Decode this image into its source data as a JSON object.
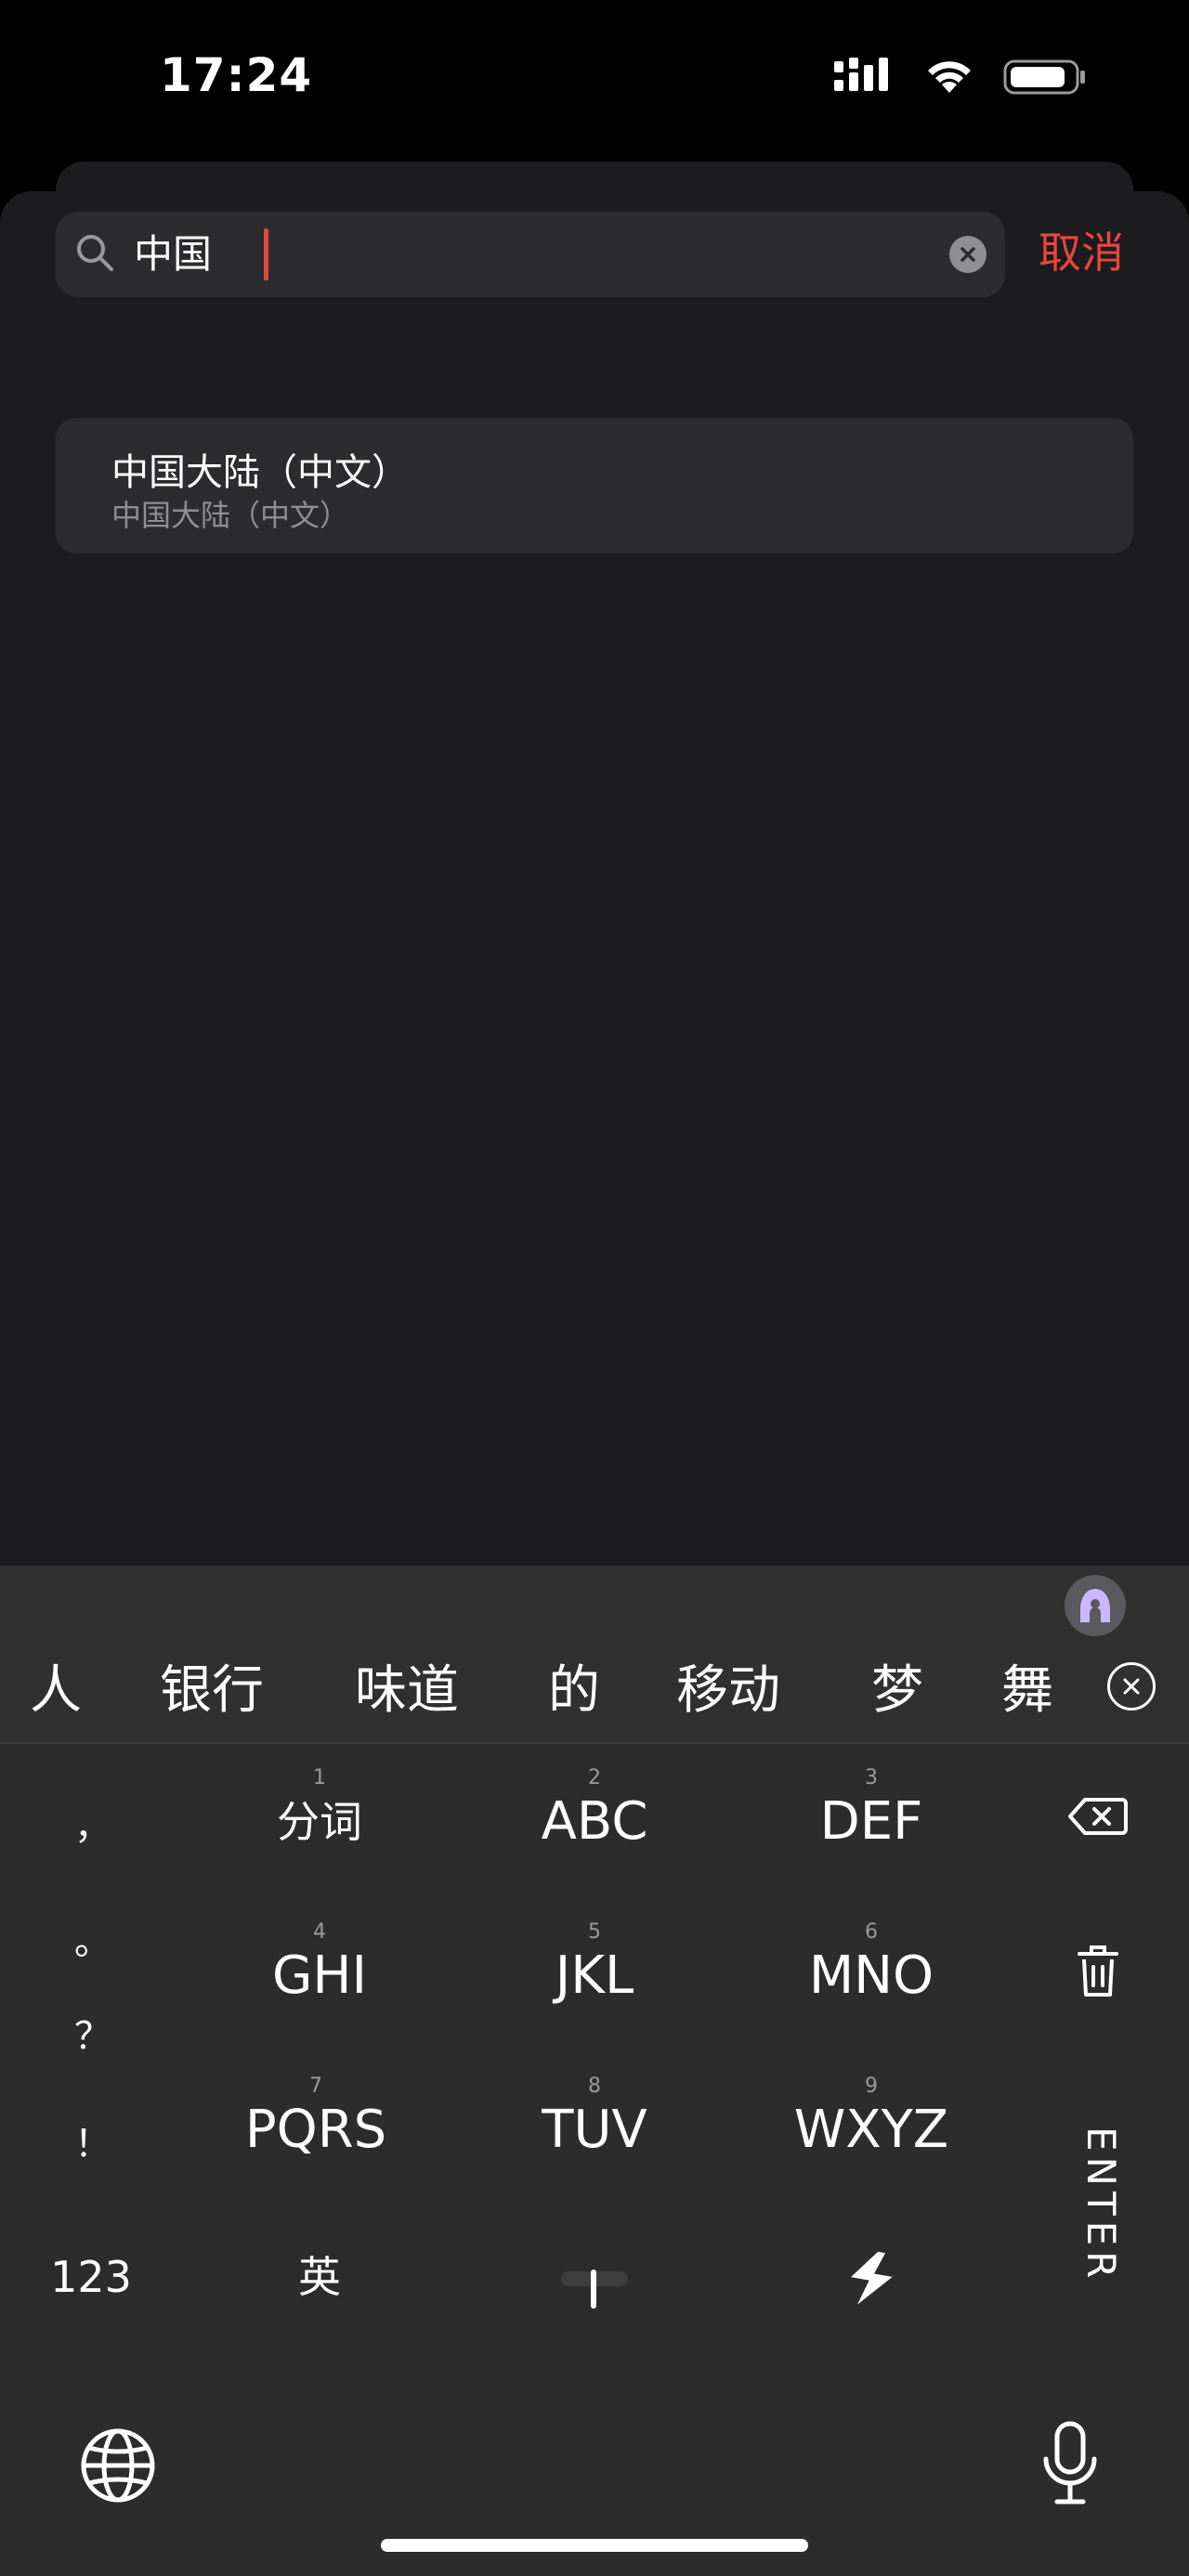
{
  "status": {
    "time": "17:24"
  },
  "search": {
    "value": "中国",
    "cancel_label": "取消"
  },
  "results": [
    {
      "title": "中国大陆（中文）",
      "subtitle": "中国大陆（中文）"
    }
  ],
  "keyboard": {
    "candidates": [
      "人",
      "银行",
      "味道",
      "的",
      "移动",
      "梦",
      "舞"
    ],
    "punctuation": [
      "，",
      "。",
      "？",
      "！"
    ],
    "keys": [
      {
        "num": "1",
        "label": "分词"
      },
      {
        "num": "2",
        "label": "ABC"
      },
      {
        "num": "3",
        "label": "DEF"
      },
      {
        "num": "4",
        "label": "GHI"
      },
      {
        "num": "5",
        "label": "JKL"
      },
      {
        "num": "6",
        "label": "MNO"
      },
      {
        "num": "7",
        "label": "PQRS"
      },
      {
        "num": "8",
        "label": "TUV"
      },
      {
        "num": "9",
        "label": "WXYZ"
      }
    ],
    "numbers_label": "123",
    "english_label": "英",
    "enter_label": "ENTER"
  },
  "colors": {
    "accent": "#e5473e",
    "sheet": "#1c1c1e",
    "field": "#2c2c2e"
  }
}
